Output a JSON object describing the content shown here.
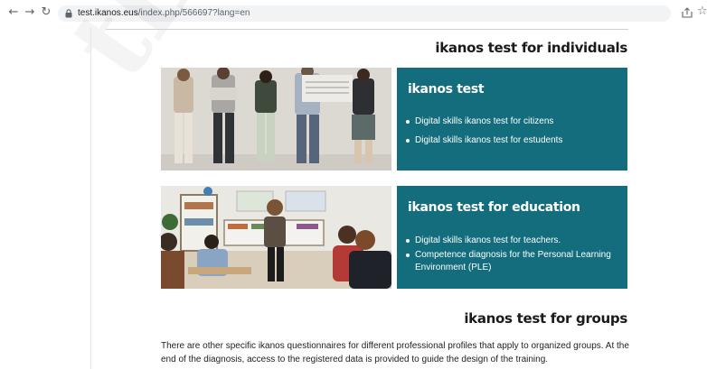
{
  "browser": {
    "url_host": "test.ikanos.eus",
    "url_path": "/index.php/566697?lang=en"
  },
  "sections": {
    "individuals_heading": "ikanos test for individuals",
    "groups_heading": "ikanos test for groups",
    "groups_text": "There are other specific ikanos questionnaires for different professional profiles that apply to organized groups. At the end of the diagnosis, access to the registered data is provided to guide the design of the training."
  },
  "cards": [
    {
      "title": "ikanos test",
      "items": [
        "Digital skills ikanos test for citizens",
        "Digital skills ikanos test for estudents"
      ]
    },
    {
      "title": "ikanos test for education",
      "items": [
        "Digital skills ikanos test for teachers.",
        "Competence diagnosis for the Personal Learning Environment (PLE)"
      ]
    }
  ],
  "colors": {
    "card_bg": "#136d7c",
    "accent": "#136d7c"
  },
  "icons": [
    "back-icon",
    "forward-icon",
    "reload-icon",
    "lock-icon",
    "share-icon",
    "star-icon"
  ]
}
